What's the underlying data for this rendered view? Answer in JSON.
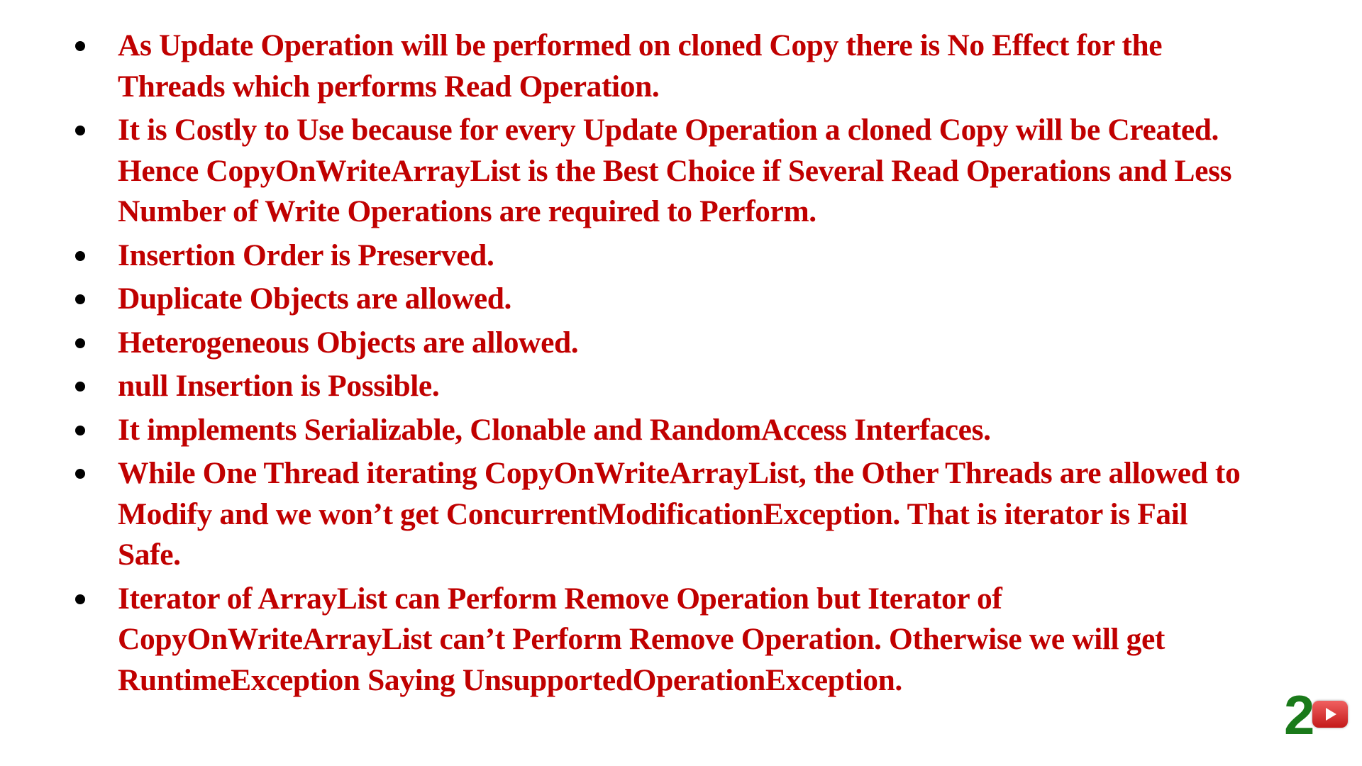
{
  "bullets": [
    "As Update Operation will be performed on cloned Copy there is No Effect for the Threads which performs Read Operation.",
    "It is Costly to Use because for every Update Operation a cloned Copy will be Created. Hence CopyOnWriteArrayList is the Best Choice if Several Read Operations and Less Number of Write Operations are required to Perform.",
    "Insertion Order is Preserved.",
    "Duplicate Objects are allowed.",
    "Heterogeneous Objects are allowed.",
    "null Insertion is Possible.",
    "It implements Serializable, Clonable and RandomAccess Interfaces.",
    "While One Thread iterating CopyOnWriteArrayList, the Other Threads are allowed to Modify and we won’t get ConcurrentModificationException. That is iterator is Fail Safe.",
    "Iterator of ArrayList can Perform Remove Operation but Iterator of CopyOnWriteArrayList can’t Perform Remove Operation. Otherwise we will get RuntimeException Saying UnsupportedOperationException."
  ],
  "corner_logo": {
    "digit": "2",
    "icon": "play-button-icon"
  },
  "colors": {
    "text": "#c00000",
    "bullet": "#000000",
    "background": "#ffffff",
    "digit": "#1a7a1a",
    "play_button": "#d42a2a"
  }
}
